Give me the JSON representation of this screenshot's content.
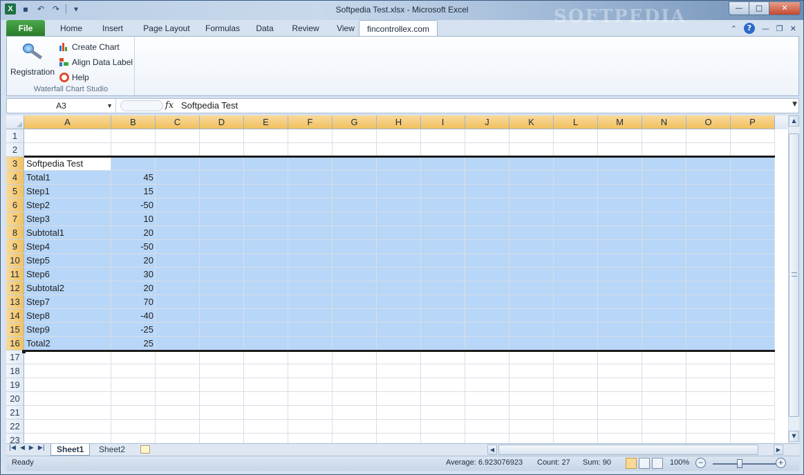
{
  "window": {
    "title": "Softpedia Test.xlsx - Microsoft Excel"
  },
  "qat": {
    "app_icon": "X"
  },
  "tabs": [
    {
      "label": "File",
      "key": "file"
    },
    {
      "label": "Home",
      "key": "home"
    },
    {
      "label": "Insert",
      "key": "insert"
    },
    {
      "label": "Page Layout",
      "key": "page-layout"
    },
    {
      "label": "Formulas",
      "key": "formulas"
    },
    {
      "label": "Data",
      "key": "data"
    },
    {
      "label": "Review",
      "key": "review"
    },
    {
      "label": "View",
      "key": "view"
    },
    {
      "label": "fincontrollex.com",
      "key": "fincontrollex"
    }
  ],
  "ribbon": {
    "registration_label": "Registration",
    "create_chart_label": "Create Chart",
    "align_data_label": "Align Data Label",
    "help_label": "Help",
    "group_label": "Waterfall Chart Studio"
  },
  "formula_bar": {
    "name_box": "A3",
    "fx": "fx",
    "formula": "Softpedia Test"
  },
  "grid": {
    "columns": [
      "A",
      "B",
      "C",
      "D",
      "E",
      "F",
      "G",
      "H",
      "I",
      "J",
      "K",
      "L",
      "M",
      "N",
      "O",
      "P"
    ],
    "rows": [
      "1",
      "2",
      "3",
      "4",
      "5",
      "6",
      "7",
      "8",
      "9",
      "10",
      "11",
      "12",
      "13",
      "14",
      "15",
      "16",
      "17",
      "18",
      "19",
      "20",
      "21",
      "22",
      "23"
    ],
    "data": [
      {
        "row": 3,
        "a": "Softpedia Test",
        "b": ""
      },
      {
        "row": 4,
        "a": "Total1",
        "b": "45"
      },
      {
        "row": 5,
        "a": "Step1",
        "b": "15"
      },
      {
        "row": 6,
        "a": "Step2",
        "b": "-50"
      },
      {
        "row": 7,
        "a": "Step3",
        "b": "10"
      },
      {
        "row": 8,
        "a": "Subtotal1",
        "b": "20"
      },
      {
        "row": 9,
        "a": "Step4",
        "b": "-50"
      },
      {
        "row": 10,
        "a": "Step5",
        "b": "20"
      },
      {
        "row": 11,
        "a": "Step6",
        "b": "30"
      },
      {
        "row": 12,
        "a": "Subtotal2",
        "b": "20"
      },
      {
        "row": 13,
        "a": "Step7",
        "b": "70"
      },
      {
        "row": 14,
        "a": "Step8",
        "b": "-40"
      },
      {
        "row": 15,
        "a": "Step9",
        "b": "-25"
      },
      {
        "row": 16,
        "a": "Total2",
        "b": "25"
      }
    ]
  },
  "sheets": [
    {
      "label": "Sheet1",
      "active": true
    },
    {
      "label": "Sheet2",
      "active": false
    }
  ],
  "status": {
    "ready": "Ready",
    "average": "Average: 6.923076923",
    "count": "Count: 27",
    "sum": "Sum: 90",
    "zoom": "100%"
  },
  "watermark": "SOFTPEDIA",
  "colors": {
    "selection": "#a0c8f5",
    "header_selected": "#f1c15f",
    "file_tab": "#2a7a2a"
  }
}
